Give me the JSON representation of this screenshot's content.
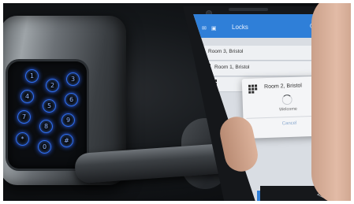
{
  "app": {
    "title": "Locks",
    "status_icons": "◉ ✉ ▣",
    "header_icon": "lock-icon"
  },
  "locks": [
    {
      "label": "Room 3, Bristol"
    },
    {
      "label": "Room 1, Bristol"
    },
    {
      "label": "Room 2, Bristol"
    }
  ],
  "dialog": {
    "title": "Room 2, Bristol",
    "message": "Welcome",
    "cancel_label": "Cancel"
  },
  "nav": {
    "back": "◁",
    "home": "○"
  },
  "keypad": {
    "keys": [
      "1",
      "2",
      "3",
      "4",
      "5",
      "6",
      "7",
      "8",
      "9",
      "*",
      "0",
      "#"
    ]
  },
  "colors": {
    "app_bar": "#2f7fd8",
    "keypad_glow": "#2a63ff"
  }
}
